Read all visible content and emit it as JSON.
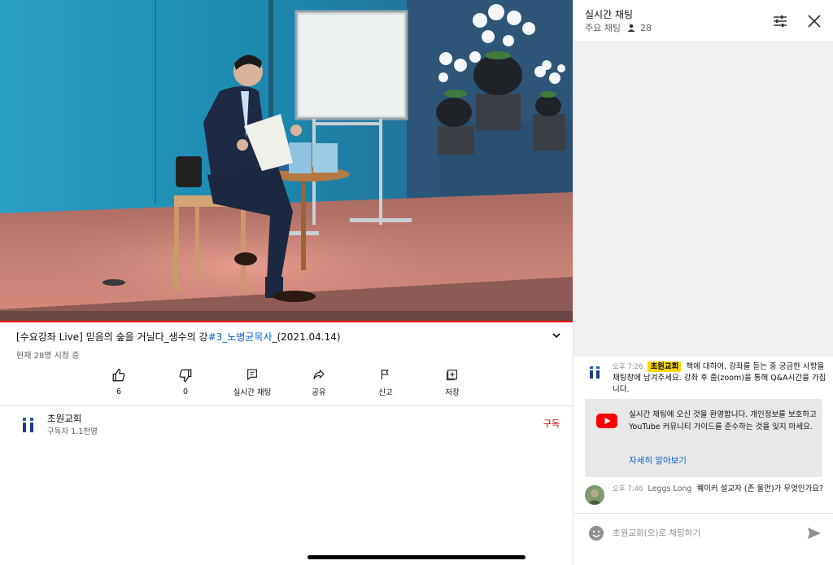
{
  "video": {
    "title_prefix": "[수요강좌 Live] 믿음의 숲을 거닐다_생수의 강",
    "title_link": "#3_노병균목사",
    "title_suffix": "_(2021.04.14)",
    "viewers": "현재 28명 시청 중",
    "progress_percent": 100
  },
  "actions": [
    {
      "icon": "thumbs-up-icon",
      "label": "6"
    },
    {
      "icon": "thumbs-down-icon",
      "label": "0"
    },
    {
      "icon": "live-chat-icon",
      "label": "실시간 채팅"
    },
    {
      "icon": "share-icon",
      "label": "공유"
    },
    {
      "icon": "flag-icon",
      "label": "신고"
    },
    {
      "icon": "save-icon",
      "label": "저장"
    }
  ],
  "channel": {
    "name": "초원교회",
    "subscribers": "구독자 1.1천명",
    "subscribe_label": "구독"
  },
  "chat": {
    "title": "실시간 채팅",
    "mode": "주요 채팅",
    "viewer_count": "28",
    "messages": [
      {
        "time": "오후 7:26",
        "author": "초원교회",
        "text": "책에 대하여, 강좌를 듣는 중 궁금한 사항을 채팅창에 남겨주세요. 강좌 후 줌(zoom)을 통해 Q&A시간을 가집니다."
      },
      {
        "time": "오후 7:46",
        "author": "Leggs Long",
        "text": "퀘이커 설교자 (존 울먼)가 무엇인가요?"
      }
    ],
    "welcome_text": "실시간 채팅에 오신 것을 환영합니다. 개인정보를 보호하고 YouTube 커뮤니티 가이드를 준수하는 것을 잊지 마세요.",
    "welcome_link": "자세히 알아보기",
    "input_placeholder": "초원교회(으)로 채팅하기"
  },
  "colors": {
    "accent_link": "#065fd4",
    "progress": "#ff0000",
    "owner_badge": "#ffd600",
    "subscribe": "#cc0000"
  }
}
